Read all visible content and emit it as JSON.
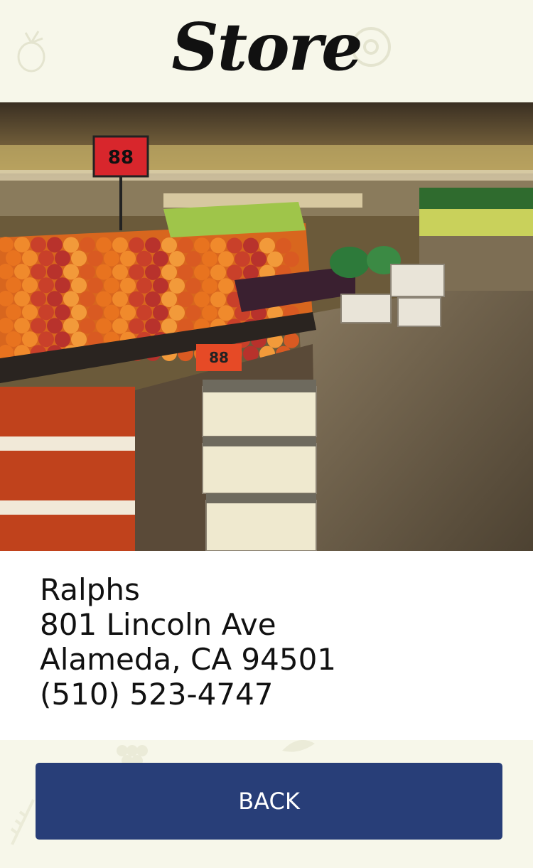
{
  "header": {
    "title": "Store"
  },
  "store": {
    "name": "Ralphs",
    "street": "801 Lincoln Ave",
    "city_line": "Alameda, CA 94501",
    "phone": "(510) 523-4747"
  },
  "photo": {
    "sign_price": "88",
    "bin_price": "88"
  },
  "actions": {
    "back_label": "BACK"
  },
  "colors": {
    "page_background": "#f7f7ea",
    "info_background": "#ffffff",
    "button_background": "#283e78",
    "button_text": "#ffffff"
  }
}
